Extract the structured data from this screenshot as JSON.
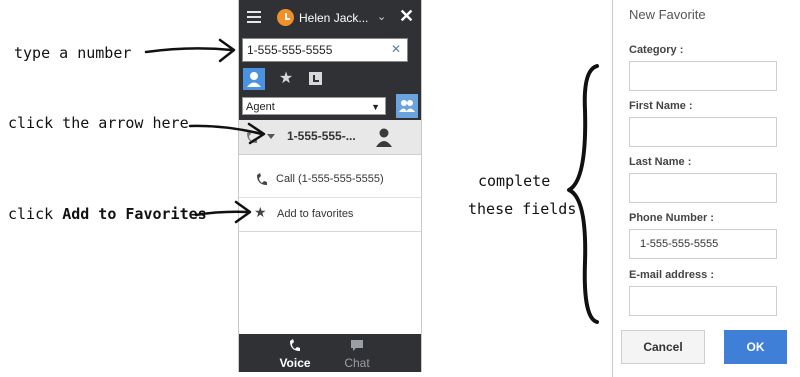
{
  "annotations": {
    "type_number": "type a number",
    "click_arrow": "click the arrow  here",
    "click_add_prefix": "click",
    "click_add_bold": "Add to Favorites",
    "complete_line1": "complete",
    "complete_line2": "these fields"
  },
  "panel": {
    "agent_name": "Helen Jack...",
    "status_color": "#f0902a",
    "close_glyph": "✕",
    "search": {
      "value": "1-555-555-5555",
      "clear_glyph": "✕"
    },
    "filter": {
      "selected": "Agent"
    },
    "result": {
      "number": "1-555-555-..."
    },
    "menu": {
      "call_label": "Call (1-555-555-5555)",
      "favorite_label": "Add to favorites"
    },
    "bottom_tabs": {
      "voice": "Voice",
      "chat": "Chat"
    },
    "accent_color": "#4c92e0",
    "dark_bar_color": "#2f3135"
  },
  "dialog": {
    "title": "New Favorite",
    "fields": [
      {
        "label": "Category :",
        "value": ""
      },
      {
        "label": "First Name :",
        "value": ""
      },
      {
        "label": "Last Name :",
        "value": ""
      },
      {
        "label": "Phone Number :",
        "value": "1-555-555-5555"
      },
      {
        "label": "E-mail address :",
        "value": ""
      }
    ],
    "cancel_label": "Cancel",
    "ok_label": "OK",
    "ok_color": "#3f7fd8"
  }
}
